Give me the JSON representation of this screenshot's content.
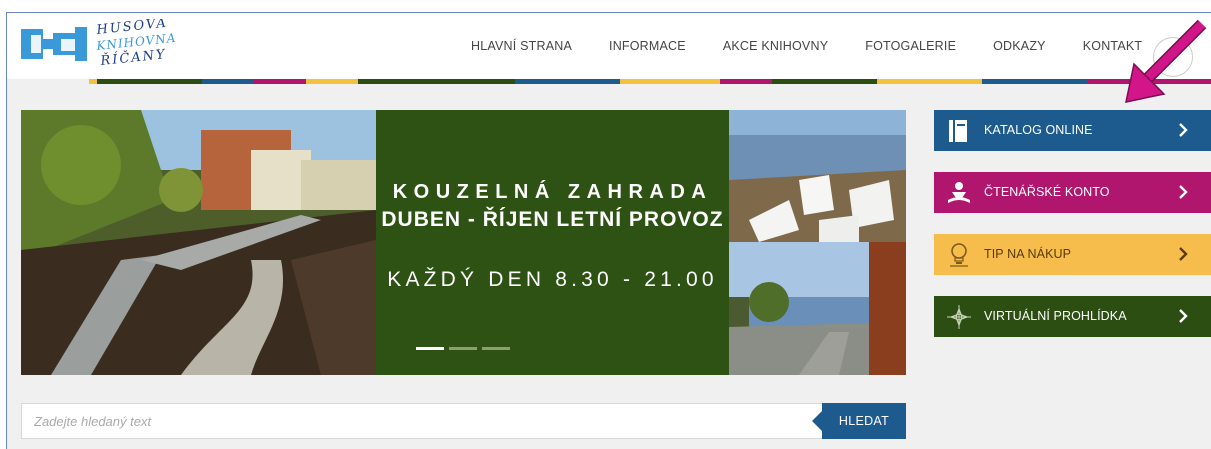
{
  "logo": {
    "line1": "HUSOVA",
    "line2": "KNIHOVNA",
    "line3": "ŘÍČANY",
    "colors": {
      "blue": "#3a9ad9",
      "navy": "#1d3f8a"
    }
  },
  "nav": {
    "items": [
      {
        "label": "HLAVNÍ STRANA"
      },
      {
        "label": "INFORMACE"
      },
      {
        "label": "AKCE KNIHOVNY"
      },
      {
        "label": "FOTOGALERIE"
      },
      {
        "label": "ODKAZY"
      },
      {
        "label": "KONTAKT"
      }
    ]
  },
  "stripe_colors": [
    "#f2c13e",
    "#2c4e13",
    "#1d5a8e",
    "#b1166f",
    "#f2c13e",
    "#2c4e13",
    "#2c4e13",
    "#1d5a8e",
    "#f2c13e",
    "#b1166f",
    "#2c4e13",
    "#f2c13e",
    "#1d5a8e",
    "#b1166f"
  ],
  "slider": {
    "title_line1": "KOUZELNÁ ZAHRADA",
    "title_line2": "DUBEN - ŘÍJEN LETNÍ PROVOZ",
    "title_line3": "KAŽDÝ DEN 8.30 - 21.00",
    "active_dot": 1,
    "dot_count": 3
  },
  "side_buttons": [
    {
      "label": "KATALOG ONLINE",
      "icon": "book-icon",
      "color": "#1d5a8e"
    },
    {
      "label": "ČTENÁŘSKÉ KONTO",
      "icon": "reader-icon",
      "color": "#b1166f"
    },
    {
      "label": "TIP NA NÁKUP",
      "icon": "lightbulb-icon",
      "color": "#f6bc4c"
    },
    {
      "label": "VIRTUÁLNÍ PROHLÍDKA",
      "icon": "compass-icon",
      "color": "#2c4e13"
    }
  ],
  "search": {
    "placeholder": "Zadejte hledaný text",
    "button_label": "HLEDAT"
  },
  "annotation": {
    "arrow_color": "#c0137a"
  }
}
